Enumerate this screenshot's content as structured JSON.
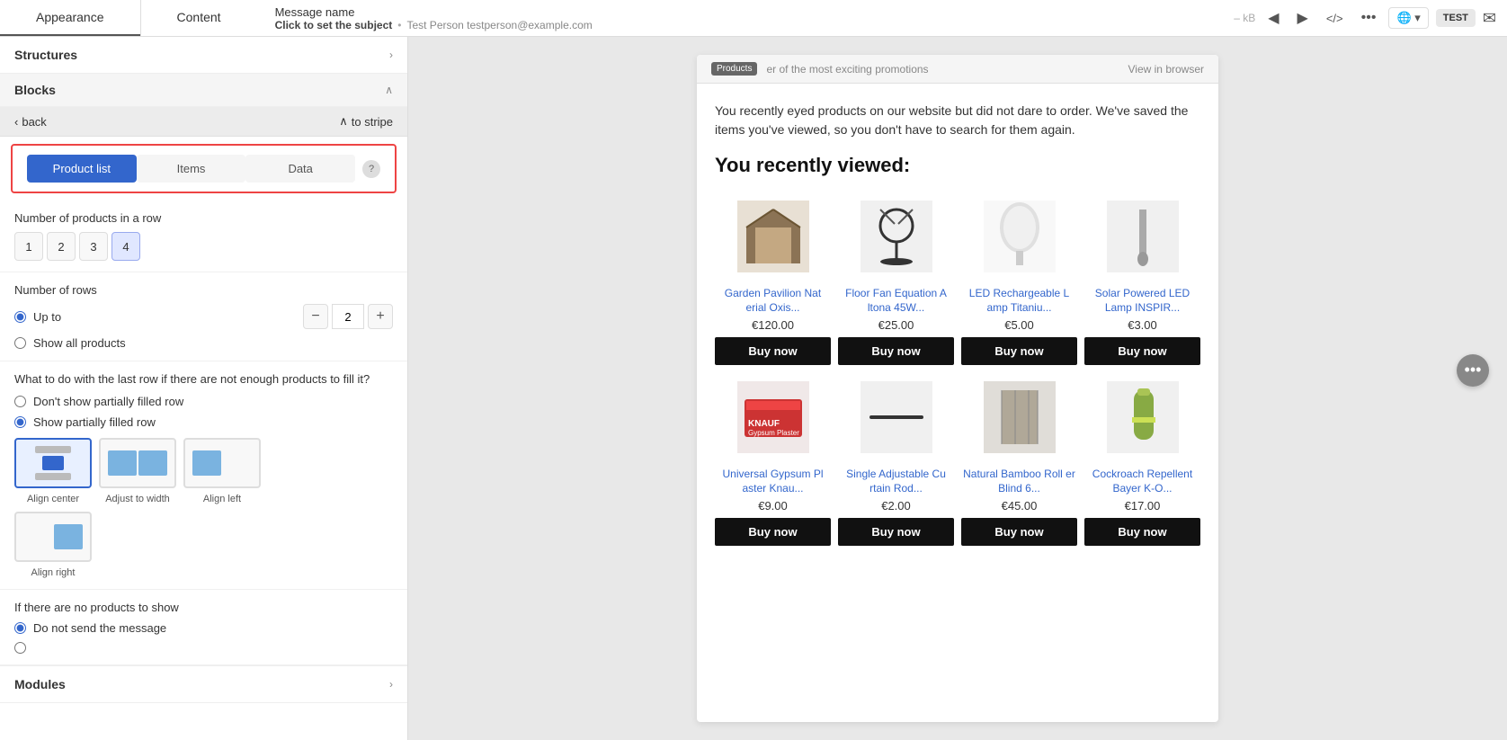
{
  "tabs": {
    "appearance": "Appearance",
    "content": "Content"
  },
  "message": {
    "name_label": "Message name",
    "subject_label": "Click to set the subject",
    "subject_separator": "•",
    "recipient": "Test Person testperson@example.com",
    "kb": "– kB"
  },
  "top_actions": {
    "back": "◀",
    "forward": "▶",
    "code": "</>",
    "more": "...",
    "test": "TEST",
    "send": "✉"
  },
  "left_panel": {
    "structures_label": "Structures",
    "blocks_label": "Blocks",
    "back_label": "back",
    "to_stripe_label": "to stripe",
    "tab_product_list": "Product list",
    "tab_items": "Items",
    "tab_data": "Data",
    "help_icon": "?",
    "products_in_row_label": "Number of products in a row",
    "numbers": [
      "1",
      "2",
      "3",
      "4"
    ],
    "active_number": 4,
    "rows_label": "Number of rows",
    "up_to": "Up to",
    "show_all": "Show all products",
    "rows_value": "2",
    "partial_question": "What to do with the last row if there are not enough products to fill it?",
    "dont_show": "Don't show partially filled row",
    "show_partial": "Show partially filled row",
    "align_center": "Align center",
    "adjust_width": "Adjust to width",
    "align_left": "Align left",
    "align_right": "Align right",
    "no_products_label": "If there are no products to show",
    "do_not_send": "Do not send the message",
    "modules_label": "Modules"
  },
  "email": {
    "products_badge": "Products",
    "promo_text": "er of the most exciting promotions",
    "view_browser": "View in browser",
    "intro": "You recently eyed products on our website but did not dare to order. We've saved the items you've viewed, so you don't have to search for them again.",
    "title": "You recently viewed:",
    "products": [
      {
        "name": "Garden Pavilion Nat erial Oxis...",
        "price": "€120.00",
        "buy": "Buy now",
        "color": "#8B7355",
        "icon": "⛺"
      },
      {
        "name": "Floor Fan Equation A ltona 45W...",
        "price": "€25.00",
        "buy": "Buy now",
        "color": "#333",
        "icon": "🌀"
      },
      {
        "name": "LED Rechargeable L amp Titaniu...",
        "price": "€5.00",
        "buy": "Buy now",
        "color": "#eee",
        "icon": "💡"
      },
      {
        "name": "Solar Powered LED Lamp INSPIR...",
        "price": "€3.00",
        "buy": "Buy now",
        "color": "#aaa",
        "icon": "🔦"
      },
      {
        "name": "Universal Gypsum Pl aster Knau...",
        "price": "€9.00",
        "buy": "Buy now",
        "color": "#cc2222",
        "icon": "📦"
      },
      {
        "name": "Single Adjustable Cu rtain Rod...",
        "price": "€2.00",
        "buy": "Buy now",
        "color": "#333",
        "icon": "—"
      },
      {
        "name": "Natural Bamboo Roll er Blind 6...",
        "price": "€45.00",
        "buy": "Buy now",
        "color": "#999",
        "icon": "▬"
      },
      {
        "name": "Cockroach Repellent Bayer K-O...",
        "price": "€17.00",
        "buy": "Buy now",
        "color": "#88aa44",
        "icon": "🧴"
      }
    ]
  }
}
